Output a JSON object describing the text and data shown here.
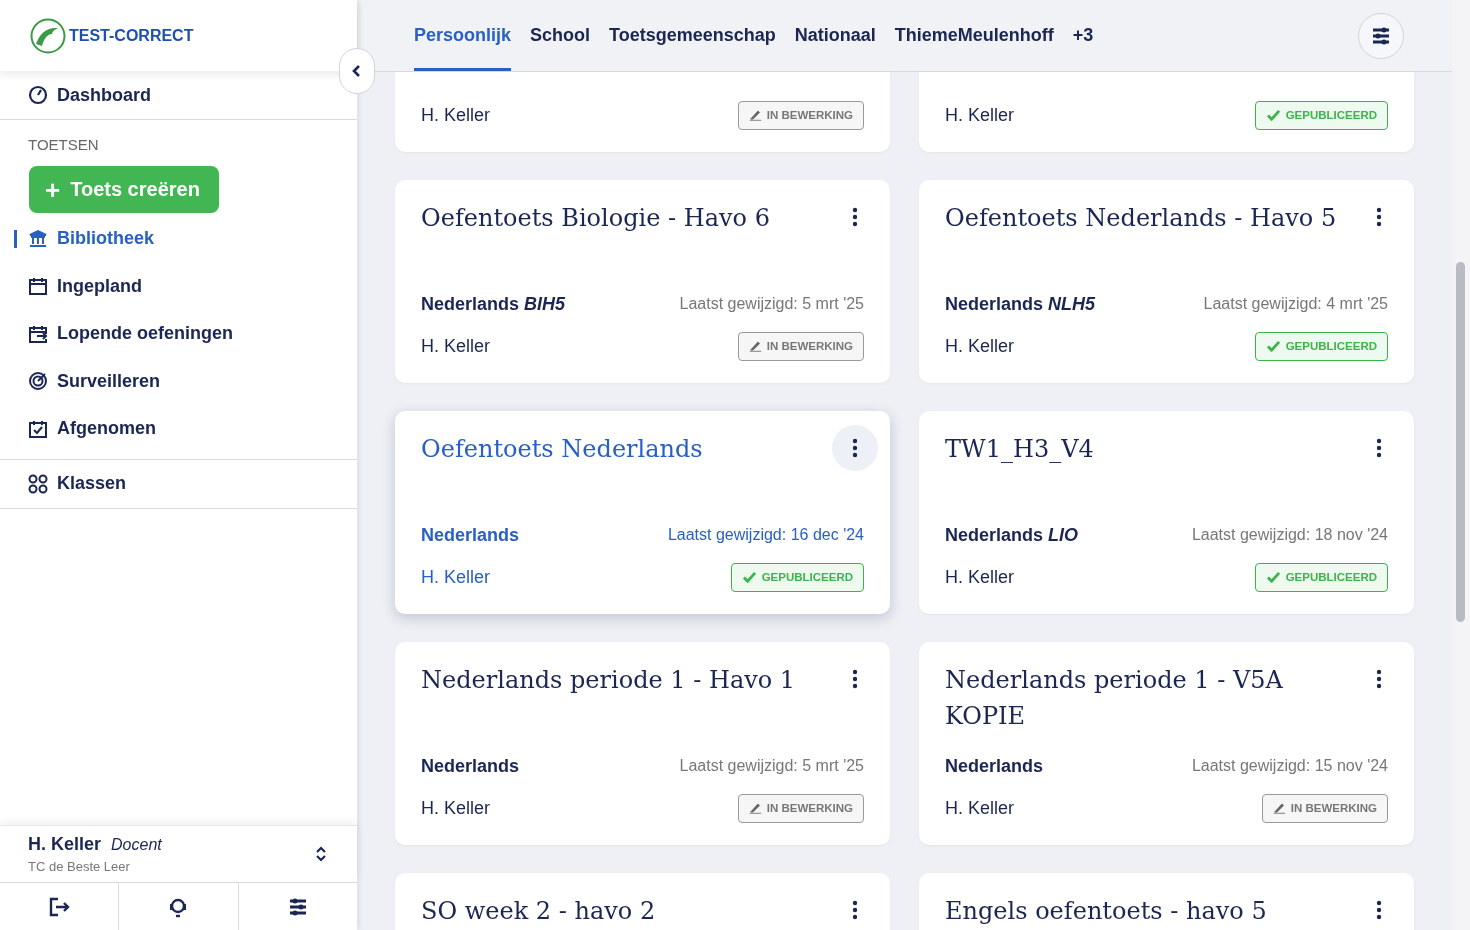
{
  "logo": {
    "text": "TEST-CORRECT"
  },
  "nav": [
    {
      "label": "Dashboard",
      "kind": "dashboard",
      "selected": false
    }
  ],
  "section_title": "TOETSEN",
  "create_button": {
    "label": "Toets creëren",
    "icon": "+"
  },
  "menu": [
    {
      "label": "Bibliotheek",
      "kind": "library",
      "selected": true
    },
    {
      "label": "Ingepland",
      "kind": "calendar",
      "selected": false
    },
    {
      "label": "Lopende oefeningen",
      "kind": "running",
      "selected": false
    },
    {
      "label": "Surveilleren",
      "kind": "radar",
      "selected": false
    },
    {
      "label": "Afgenomen",
      "kind": "done",
      "selected": false
    }
  ],
  "classes_item": {
    "label": "Klassen",
    "kind": "classes",
    "selected": false
  },
  "user": {
    "name": "H. Keller",
    "role": "Docent",
    "school": "TC de Beste Leer"
  },
  "tabs": [
    {
      "label": "Persoonlijk",
      "selected": true
    },
    {
      "label": "School",
      "selected": false
    },
    {
      "label": "Toetsgemeenschap",
      "selected": false
    },
    {
      "label": "Nationaal",
      "selected": false
    },
    {
      "label": "ThiemeMeulenhoff",
      "selected": false
    },
    {
      "label": "+3",
      "selected": false
    }
  ],
  "cards": [
    {
      "author": "H. Keller",
      "kind": "editing",
      "status_label": "IN BEWERKING",
      "selected": false
    },
    {
      "author": "H. Keller",
      "kind": "published",
      "status_label": "GEPUBLICEERD",
      "selected": false
    },
    {
      "title": "Oefentoets Biologie - Havo 6",
      "subject": "Nederlands *BIH5*",
      "date": "Laatst gewijzigd: 5 mrt '25",
      "author": "H. Keller",
      "kind": "editing",
      "status_label": "IN BEWERKING",
      "selected": false
    },
    {
      "title": "Oefentoets Nederlands - Havo 5",
      "subject": "Nederlands *NLH5*",
      "date": "Laatst gewijzigd: 4 mrt '25",
      "author": "H. Keller",
      "kind": "published",
      "status_label": "GEPUBLICEERD",
      "selected": false
    },
    {
      "title": "Oefentoets Nederlands",
      "subject": "Nederlands",
      "date": "Laatst gewijzigd: 16 dec '24",
      "author": "H. Keller",
      "kind": "published",
      "status_label": "GEPUBLICEERD",
      "selected": true
    },
    {
      "title": "TW1_H3_V4",
      "subject": "Nederlands *LIO*",
      "date": "Laatst gewijzigd: 18 nov '24",
      "author": "H. Keller",
      "kind": "published",
      "status_label": "GEPUBLICEERD",
      "selected": false
    },
    {
      "title": "Nederlands periode 1 - Havo 1",
      "subject": "Nederlands",
      "date": "Laatst gewijzigd: 5 mrt '25",
      "author": "H. Keller",
      "kind": "editing",
      "status_label": "IN BEWERKING",
      "selected": false
    },
    {
      "title": "Nederlands periode 1 - V5A KOPIE",
      "subject": "Nederlands",
      "date": "Laatst gewijzigd: 15 nov '24",
      "author": "H. Keller",
      "kind": "editing",
      "status_label": "IN BEWERKING",
      "selected": false
    },
    {
      "title": "SO week 2 - havo 2",
      "selected": false
    },
    {
      "title": "Engels oefentoets - havo 5",
      "selected": false
    }
  ]
}
